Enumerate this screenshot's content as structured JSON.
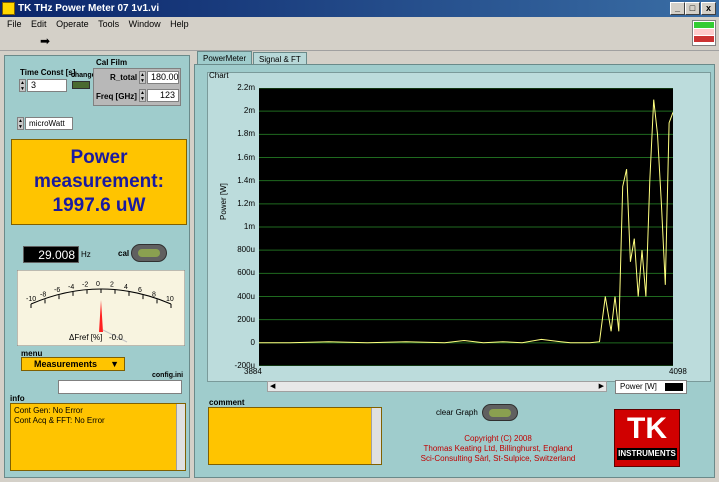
{
  "window": {
    "title": "TK THz Power Meter 07 1v1.vi",
    "min_label": "_",
    "max_label": "□",
    "close_label": "x"
  },
  "menu": [
    "File",
    "Edit",
    "Operate",
    "Tools",
    "Window",
    "Help"
  ],
  "controls": {
    "time_const_label": "Time Const [s]",
    "time_const_value": "3",
    "change_label": "change",
    "cal_film_label": "Cal Film",
    "r_total_label": "R_total",
    "r_total_value": "180.00",
    "freq_label": "Freq [GHz]",
    "freq_value": "123",
    "unit_value": "microWatt",
    "display_text": "Power measurement: 1997.6 uW",
    "hz_value": "29.008",
    "hz_unit": "Hz",
    "cal_label": "cal",
    "meter_ticks": [
      "-10",
      "-8",
      "-6",
      "-4",
      "-2",
      "0",
      "2",
      "4",
      "6",
      "8",
      "10"
    ],
    "meter_label": "ΔFref [%]",
    "meter_value": "-0.0",
    "menu_label": "menu",
    "measurements_value": "Measurements",
    "config_label": "config.ini",
    "info_label": "info",
    "info_lines": [
      "Cont Gen: No Error",
      "Cont Acq & FFT:  No Error"
    ]
  },
  "tabs": [
    {
      "label": "PowerMeter",
      "active": true
    },
    {
      "label": "Signal & FT",
      "active": false
    }
  ],
  "chart": {
    "panel_label": "Chart",
    "legend_label": "Power [W]",
    "comment_label": "comment",
    "clear_label": "clear Graph",
    "copyright": [
      "Copyright (C) 2008",
      "Thomas Keating Ltd, Billinghurst, England",
      "Sci-Consulting Sàrl, St-Sulpice, Switzerland"
    ],
    "logo_text": "TK",
    "logo_sub": "INSTRUMENTS"
  },
  "chart_data": {
    "type": "line",
    "ylabel": "Power [W]",
    "x_ticks": [
      "3884",
      "4098"
    ],
    "xlim": [
      3884,
      4098
    ],
    "ylim": [
      -0.0002,
      0.0022
    ],
    "y_ticks": [
      "2.2m",
      "2m",
      "1.8m",
      "1.6m",
      "1.4m",
      "1.2m",
      "1m",
      "800u",
      "600u",
      "400u",
      "200u",
      "0",
      "-200u"
    ],
    "y_tick_values": [
      0.0022,
      0.002,
      0.0018,
      0.0016,
      0.0014,
      0.0012,
      0.001,
      0.0008,
      0.0006,
      0.0004,
      0.0002,
      0,
      -0.0002
    ],
    "grid": true,
    "series": [
      {
        "color": "#ffff80",
        "x": [
          3884,
          3900,
          3920,
          3940,
          3960,
          3980,
          3990,
          4000,
          4010,
          4020,
          4030,
          4040,
          4045,
          4050,
          4055,
          4060,
          4063,
          4066,
          4068,
          4070,
          4072,
          4074,
          4076,
          4078,
          4080,
          4082,
          4084,
          4086,
          4088,
          4090,
          4092,
          4094,
          4096,
          4098
        ],
        "y": [
          0,
          0,
          1e-05,
          0,
          1e-05,
          0,
          2e-05,
          0,
          1e-05,
          0,
          3e-05,
          1e-05,
          0,
          0,
          0,
          1e-05,
          0.0004,
          0.0001,
          0.0004,
          0.0001,
          0.00135,
          0.0015,
          0.0007,
          0.0009,
          0.0004,
          0.0008,
          0.0004,
          0.0014,
          0.0021,
          0.0018,
          0.0012,
          0.0005,
          0.0019,
          0.00199
        ]
      }
    ]
  }
}
